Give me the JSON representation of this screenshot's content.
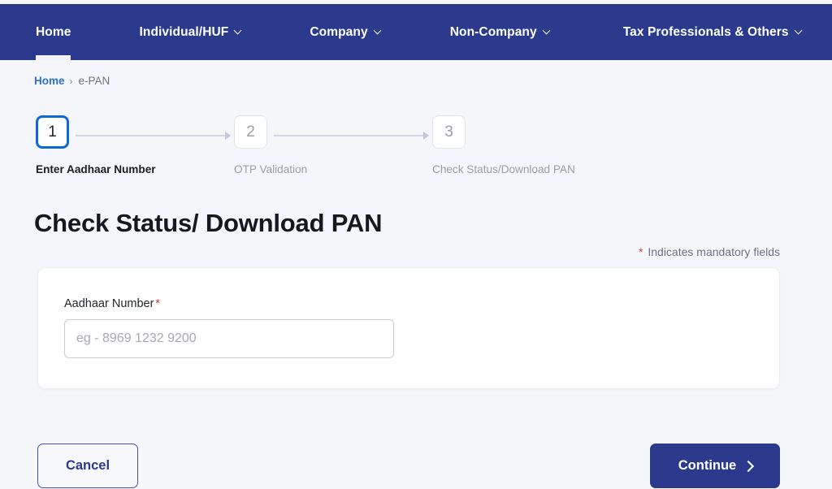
{
  "nav": {
    "items": [
      {
        "label": "Home",
        "has_dropdown": false,
        "active": true
      },
      {
        "label": "Individual/HUF",
        "has_dropdown": true,
        "active": false
      },
      {
        "label": "Company",
        "has_dropdown": true,
        "active": false
      },
      {
        "label": "Non-Company",
        "has_dropdown": true,
        "active": false
      },
      {
        "label": "Tax Professionals & Others",
        "has_dropdown": true,
        "active": false
      }
    ],
    "background_color": "#2b3a8c",
    "text_color": "#ffffff"
  },
  "breadcrumb": {
    "home_label": "Home",
    "separator": "›",
    "current_label": "e-PAN",
    "link_color": "#2f6fd0"
  },
  "stepper": {
    "steps": [
      {
        "number": "1",
        "label": "Enter Aadhaar Number",
        "state": "active"
      },
      {
        "number": "2",
        "label": "OTP Validation",
        "state": "inactive"
      },
      {
        "number": "3",
        "label": "Check Status/Download PAN",
        "state": "inactive"
      }
    ],
    "active_color": "#0e69d6",
    "inactive_color": "#9a9ea9"
  },
  "page": {
    "title": "Check Status/ Download PAN",
    "mandatory_note_star": "*",
    "mandatory_note_text": " Indicates mandatory fields",
    "required_color": "#e0333f"
  },
  "form": {
    "aadhaar_label": "Aadhaar Number",
    "aadhaar_required_mark": "*",
    "aadhaar_value": "",
    "aadhaar_placeholder": "eg - 8969 1232 9200"
  },
  "footer": {
    "cancel_label": "Cancel",
    "continue_label": "Continue",
    "continue_icon": "chevron-right-icon",
    "primary_color": "#2b3a8c"
  }
}
